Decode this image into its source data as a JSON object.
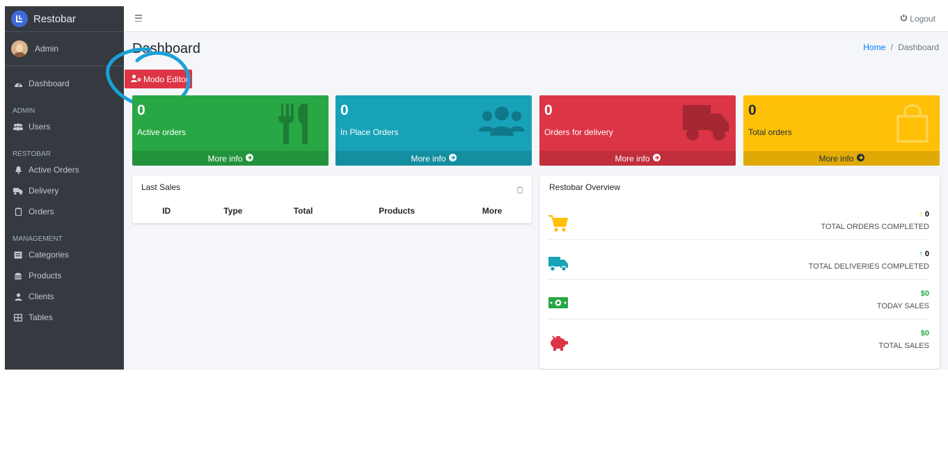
{
  "brand": {
    "name": "Restobar"
  },
  "user": {
    "name": "Admin"
  },
  "sidebar": {
    "dashboard": "Dashboard",
    "admin_header": "ADMIN",
    "users": "Users",
    "restobar_header": "RESTOBAR",
    "active_orders": "Active Orders",
    "delivery": "Delivery",
    "orders": "Orders",
    "management_header": "MANAGEMENT",
    "categories": "Categories",
    "products": "Products",
    "clients": "Clients",
    "tables": "Tables"
  },
  "topbar": {
    "logout": "Logout"
  },
  "page": {
    "title": "Dashboard",
    "editor_button": "Modo Editor"
  },
  "breadcrumb": {
    "home": "Home",
    "separator": "/",
    "current": "Dashboard"
  },
  "stats": [
    {
      "value": "0",
      "label": "Active orders",
      "more": "More info",
      "color": "#28a745",
      "icon": "utensils-icon"
    },
    {
      "value": "0",
      "label": "In Place Orders",
      "more": "More info",
      "color": "#17a2b8",
      "icon": "users-icon"
    },
    {
      "value": "0",
      "label": "Orders for delivery",
      "more": "More info",
      "color": "#dc3545",
      "icon": "truck-icon"
    },
    {
      "value": "0",
      "label": "Total orders",
      "more": "More info",
      "color": "#ffc107",
      "icon": "shopping-bag-icon"
    }
  ],
  "last_sales": {
    "title": "Last Sales",
    "columns": [
      "ID",
      "Type",
      "Total",
      "Products",
      "More"
    ]
  },
  "overview": {
    "title": "Restobar Overview",
    "rows": [
      {
        "value": "0",
        "label": "TOTAL ORDERS COMPLETED",
        "icon": "shopping-cart-icon",
        "color": "#ffc107"
      },
      {
        "value": "0",
        "label": "TOTAL DELIVERIES COMPLETED",
        "icon": "truck-icon",
        "color": "#17a2b8"
      },
      {
        "value": "$0",
        "label": "TODAY SALES",
        "icon": "money-bill-icon",
        "color": "#28a745"
      },
      {
        "value": "$0",
        "label": "TOTAL SALES",
        "icon": "piggy-bank-icon",
        "color": "#dc3545"
      }
    ]
  }
}
